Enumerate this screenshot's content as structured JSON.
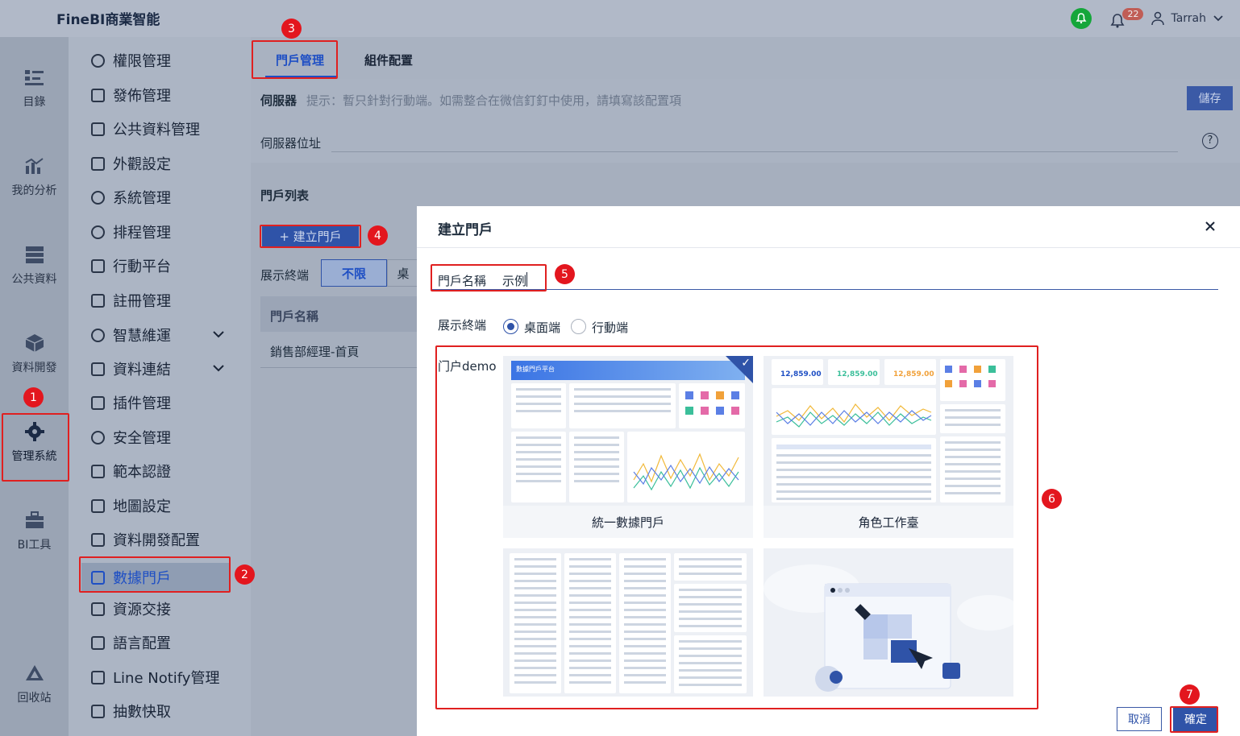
{
  "app": {
    "title": "FineBI商業智能"
  },
  "topbar": {
    "notification_count": "22",
    "user": "Tarrah"
  },
  "rail": [
    {
      "label": "目錄",
      "icon": "list-icon"
    },
    {
      "label": "我的分析",
      "icon": "chart-icon"
    },
    {
      "label": "公共資料",
      "icon": "database-icon"
    },
    {
      "label": "資料開發",
      "icon": "cube-icon"
    },
    {
      "label": "管理系統",
      "icon": "gear-icon"
    },
    {
      "label": "BI工具",
      "icon": "toolbox-icon"
    },
    {
      "label": "回收站",
      "icon": "recycle-icon"
    }
  ],
  "menu": [
    {
      "label": "權限管理"
    },
    {
      "label": "發佈管理"
    },
    {
      "label": "公共資料管理"
    },
    {
      "label": "外觀設定"
    },
    {
      "label": "系統管理"
    },
    {
      "label": "排程管理"
    },
    {
      "label": "行動平台"
    },
    {
      "label": "註冊管理"
    },
    {
      "label": "智慧維運"
    },
    {
      "label": "資料連結"
    },
    {
      "label": "插件管理"
    },
    {
      "label": "安全管理"
    },
    {
      "label": "範本認證"
    },
    {
      "label": "地圖設定"
    },
    {
      "label": "資料開發配置"
    },
    {
      "label": "數據門戶"
    },
    {
      "label": "資源交接"
    },
    {
      "label": "語言配置"
    },
    {
      "label": "Line Notify管理"
    },
    {
      "label": "抽數快取"
    }
  ],
  "main": {
    "tabs": [
      "門戶管理",
      "組件配置"
    ],
    "server_label": "伺服器",
    "server_hint": "提示：暫只針對行動端。如需整合在微信釘釘中使用，請填寫該配置項",
    "save": "儲存",
    "server_addr_label": "伺服器位址",
    "portal_list_title": "門戶列表",
    "create_btn": "+ 建立門戶",
    "terminal_label": "展示終端",
    "terminal_options": [
      "不限",
      "桌"
    ],
    "table_header": "門戶名稱",
    "table_rows": [
      "銷售部經理-首頁"
    ]
  },
  "modal": {
    "title": "建立門戶",
    "name_label": "門戶名稱",
    "name_value": "示例",
    "terminal_label": "展示終端",
    "radio_desktop": "桌面端",
    "radio_mobile": "行動端",
    "template_group": "门户demo",
    "cards": [
      "統一數據門戶",
      "角色工作臺",
      "",
      ""
    ],
    "card1_title": "數據門戶平台",
    "kpi_values": [
      "12,859.00",
      "12,859.00",
      "12,859.00"
    ],
    "cancel": "取消",
    "confirm": "確定"
  },
  "callouts": [
    "1",
    "2",
    "3",
    "4",
    "5",
    "6",
    "7"
  ]
}
